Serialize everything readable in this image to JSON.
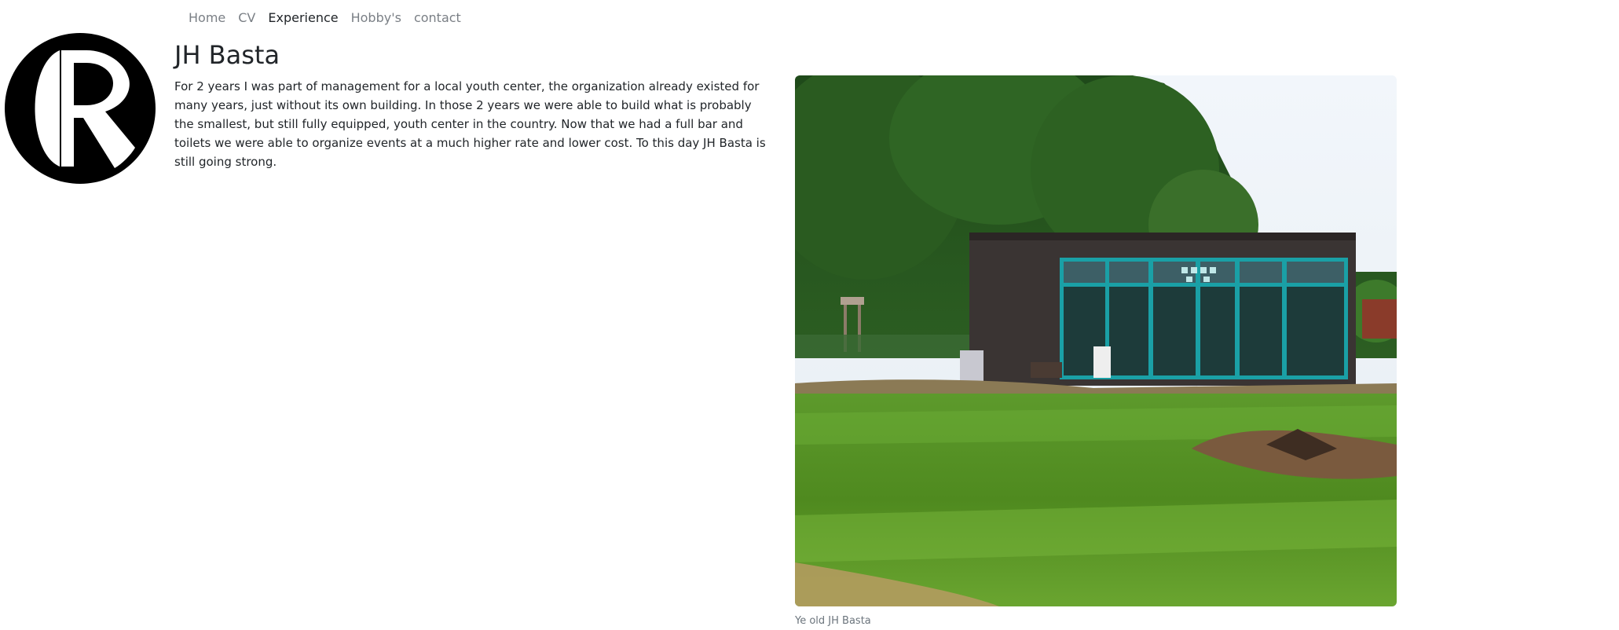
{
  "nav": {
    "items": [
      {
        "label": "Home"
      },
      {
        "label": "CV"
      },
      {
        "label": "Experience"
      },
      {
        "label": "Hobby's"
      },
      {
        "label": "contact"
      }
    ]
  },
  "page": {
    "title": "JH Basta",
    "description": "For 2 years I was part of management for a local youth center, the organization already existed for many years, just without its own building. In those 2 years we were able to build what is probably the smallest, but still fully equipped, youth center in the country. Now that we had a full bar and toilets we were able to organize events at a much higher rate and lower cost. To this day JH Basta is still going strong."
  },
  "logo": {
    "icon": "r-circle-logo-icon"
  },
  "figure": {
    "caption": "Ye old JH Basta"
  },
  "colors": {
    "text": "#212529",
    "nav_inactive": "#7a7f85",
    "caption": "#6c757d"
  }
}
